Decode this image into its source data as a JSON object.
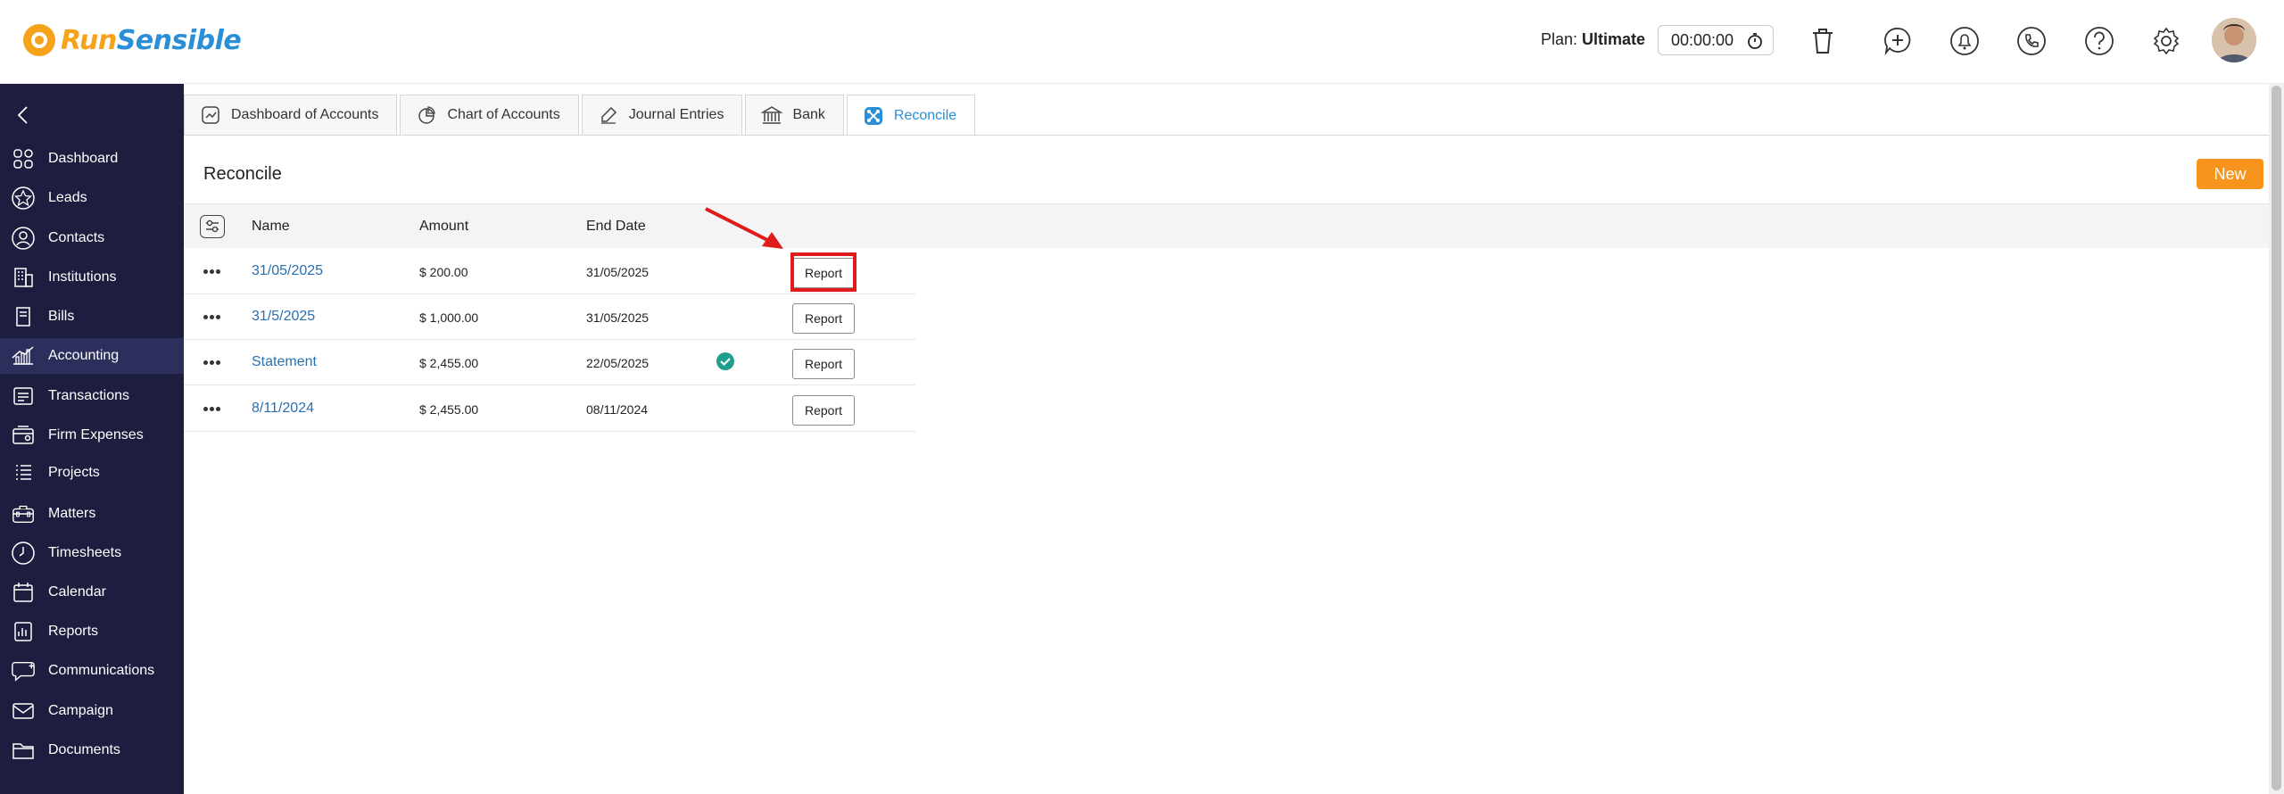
{
  "app": {
    "logo_part1": "Run",
    "logo_part2": "Sensible",
    "plan_label": "Plan:",
    "plan_value": "Ultimate",
    "timer": "00:00:00",
    "header_icons": [
      "trash-icon",
      "add-icon",
      "bell-icon",
      "phone-icon",
      "help-icon",
      "gear-icon"
    ]
  },
  "sidebar": {
    "items": [
      {
        "label": "Dashboard",
        "icon": "dashboard-icon"
      },
      {
        "label": "Leads",
        "icon": "star-icon"
      },
      {
        "label": "Contacts",
        "icon": "user-icon"
      },
      {
        "label": "Institutions",
        "icon": "building-icon"
      },
      {
        "label": "Bills",
        "icon": "bill-icon"
      },
      {
        "label": "Accounting",
        "icon": "accounting-icon",
        "active": true
      },
      {
        "label": "Transactions",
        "icon": "transactions-icon"
      },
      {
        "label": "Firm Expenses",
        "icon": "expenses-icon"
      },
      {
        "label": "Projects",
        "icon": "projects-icon"
      },
      {
        "label": "Matters",
        "icon": "briefcase-icon"
      },
      {
        "label": "Timesheets",
        "icon": "clock-icon"
      },
      {
        "label": "Calendar",
        "icon": "calendar-icon"
      },
      {
        "label": "Reports",
        "icon": "reports-icon"
      },
      {
        "label": "Communications",
        "icon": "chat-icon"
      },
      {
        "label": "Campaign",
        "icon": "mail-icon"
      },
      {
        "label": "Documents",
        "icon": "folder-icon"
      }
    ]
  },
  "tabs": [
    {
      "label": "Dashboard of Accounts",
      "icon": "chart-line-icon"
    },
    {
      "label": "Chart of Accounts",
      "icon": "pie-chart-icon"
    },
    {
      "label": "Journal Entries",
      "icon": "edit-icon"
    },
    {
      "label": "Bank",
      "icon": "bank-icon"
    },
    {
      "label": "Reconcile",
      "icon": "reconcile-icon",
      "active": true
    }
  ],
  "page": {
    "title": "Reconcile",
    "new_button": "New"
  },
  "table": {
    "columns": [
      "Name",
      "Amount",
      "End Date"
    ],
    "rows": [
      {
        "name": "31/05/2025",
        "amount": "$ 200.00",
        "end_date": "31/05/2025",
        "reconciled": false,
        "action": "Report"
      },
      {
        "name": "31/5/2025",
        "amount": "$ 1,000.00",
        "end_date": "31/05/2025",
        "reconciled": false,
        "action": "Report"
      },
      {
        "name": "Statement",
        "amount": "$ 2,455.00",
        "end_date": "22/05/2025",
        "reconciled": true,
        "action": "Report"
      },
      {
        "name": "8/11/2024",
        "amount": "$ 2,455.00",
        "end_date": "08/11/2024",
        "reconciled": false,
        "action": "Report"
      }
    ]
  },
  "colors": {
    "sidebar_bg": "#1c1d3f",
    "accent_orange": "#f7941d",
    "link_blue": "#2a6fb0",
    "tab_active": "#2a8fd6",
    "check_green": "#1f9e8e",
    "highlight_red": "#e01b1b"
  }
}
